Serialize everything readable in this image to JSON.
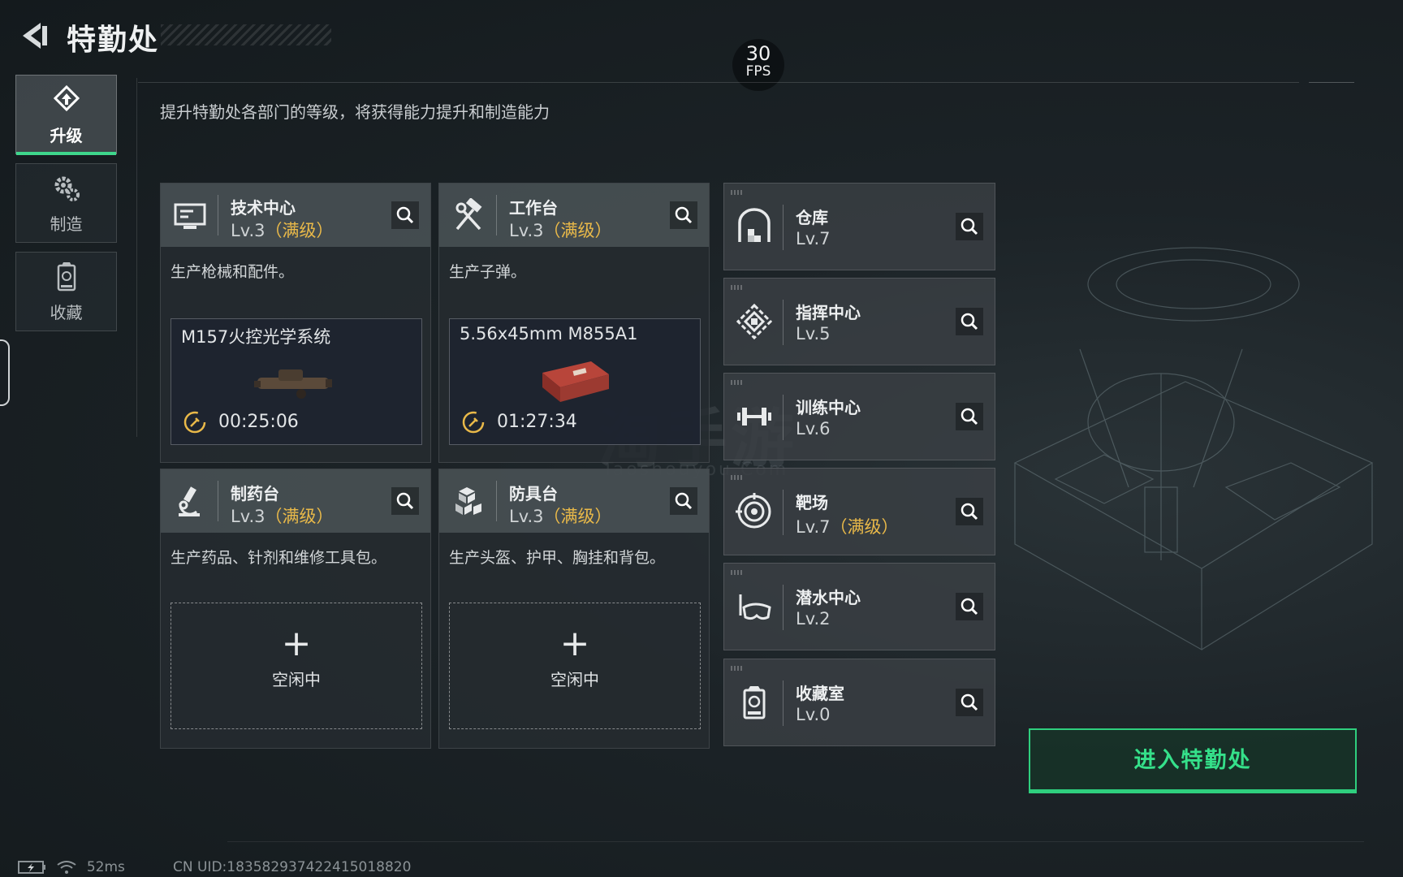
{
  "header": {
    "title": "特勤处",
    "fps_value": "30",
    "fps_unit": "FPS"
  },
  "subtitle": "提升特勤处各部门的等级，将获得能力提升和制造能力",
  "tabs": [
    {
      "label": "升级",
      "icon": "upgrade-icon",
      "active": true
    },
    {
      "label": "制造",
      "icon": "gears-icon",
      "active": false
    },
    {
      "label": "收藏",
      "icon": "collection-icon",
      "active": false
    }
  ],
  "facilities": [
    {
      "name": "技术中心",
      "level": "Lv.3",
      "max": "（满级）",
      "icon": "computer-icon",
      "desc": "生产枪械和配件。",
      "crafting": {
        "item": "M157火控光学系统",
        "time": "00:25:06"
      }
    },
    {
      "name": "工作台",
      "level": "Lv.3",
      "max": "（满级）",
      "icon": "hammer-wrench-icon",
      "desc": "生产子弹。",
      "crafting": {
        "item": "5.56x45mm M855A1",
        "time": "01:27:34"
      }
    },
    {
      "name": "制药台",
      "level": "Lv.3",
      "max": "（满级）",
      "icon": "microscope-icon",
      "desc": "生产药品、针剂和维修工具包。",
      "idle": "空闲中"
    },
    {
      "name": "防具台",
      "level": "Lv.3",
      "max": "（满级）",
      "icon": "blocks-icon",
      "desc": "生产头盔、护甲、胸挂和背包。",
      "idle": "空闲中"
    }
  ],
  "side_facilities": [
    {
      "name": "仓库",
      "level": "Lv.7",
      "max": "",
      "icon": "warehouse-icon"
    },
    {
      "name": "指挥中心",
      "level": "Lv.5",
      "max": "",
      "icon": "command-icon"
    },
    {
      "name": "训练中心",
      "level": "Lv.6",
      "max": "",
      "icon": "dumbbell-icon"
    },
    {
      "name": "靶场",
      "level": "Lv.7",
      "max": "（满级）",
      "icon": "target-icon"
    },
    {
      "name": "潜水中心",
      "level": "Lv.2",
      "max": "",
      "icon": "diving-mask-icon"
    },
    {
      "name": "收藏室",
      "level": "Lv.0",
      "max": "",
      "icon": "trophy-case-icon"
    }
  ],
  "enter_button": "进入特勤处",
  "status": {
    "ping": "52ms",
    "uid": "CN UID:183582937422415018820"
  },
  "watermark": {
    "main": "淘手游",
    "sub": "Taoshouyou.Com"
  },
  "colors": {
    "accent_green": "#2fcf7e",
    "max_level": "#e9b949"
  }
}
